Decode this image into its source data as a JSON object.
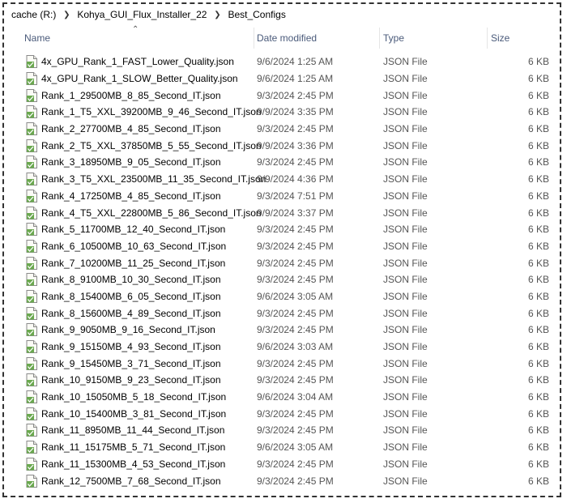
{
  "breadcrumb": [
    "cache (R:)",
    "Kohya_GUI_Flux_Installer_22",
    "Best_Configs"
  ],
  "columns": {
    "name": "Name",
    "date": "Date modified",
    "type": "Type",
    "size": "Size"
  },
  "icons": {
    "sort": "sort-ascending-icon",
    "separator": "chevron-right-icon",
    "file": "json-file-icon"
  },
  "files": [
    {
      "name": "4x_GPU_Rank_1_FAST_Lower_Quality.json",
      "date": "9/6/2024 1:25 AM",
      "type": "JSON File",
      "size": "6 KB"
    },
    {
      "name": "4x_GPU_Rank_1_SLOW_Better_Quality.json",
      "date": "9/6/2024 1:25 AM",
      "type": "JSON File",
      "size": "6 KB"
    },
    {
      "name": "Rank_1_29500MB_8_85_Second_IT.json",
      "date": "9/3/2024 2:45 PM",
      "type": "JSON File",
      "size": "6 KB"
    },
    {
      "name": "Rank_1_T5_XXL_39200MB_9_46_Second_IT.json",
      "date": "9/9/2024 3:35 PM",
      "type": "JSON File",
      "size": "6 KB"
    },
    {
      "name": "Rank_2_27700MB_4_85_Second_IT.json",
      "date": "9/3/2024 2:45 PM",
      "type": "JSON File",
      "size": "6 KB"
    },
    {
      "name": "Rank_2_T5_XXL_37850MB_5_55_Second_IT.json",
      "date": "9/9/2024 3:36 PM",
      "type": "JSON File",
      "size": "6 KB"
    },
    {
      "name": "Rank_3_18950MB_9_05_Second_IT.json",
      "date": "9/3/2024 2:45 PM",
      "type": "JSON File",
      "size": "6 KB"
    },
    {
      "name": "Rank_3_T5_XXL_23500MB_11_35_Second_IT.json",
      "date": "9/9/2024 4:36 PM",
      "type": "JSON File",
      "size": "6 KB"
    },
    {
      "name": "Rank_4_17250MB_4_85_Second_IT.json",
      "date": "9/3/2024 7:51 PM",
      "type": "JSON File",
      "size": "6 KB"
    },
    {
      "name": "Rank_4_T5_XXL_22800MB_5_86_Second_IT.json",
      "date": "9/9/2024 3:37 PM",
      "type": "JSON File",
      "size": "6 KB"
    },
    {
      "name": "Rank_5_11700MB_12_40_Second_IT.json",
      "date": "9/3/2024 2:45 PM",
      "type": "JSON File",
      "size": "6 KB"
    },
    {
      "name": "Rank_6_10500MB_10_63_Second_IT.json",
      "date": "9/3/2024 2:45 PM",
      "type": "JSON File",
      "size": "6 KB"
    },
    {
      "name": "Rank_7_10200MB_11_25_Second_IT.json",
      "date": "9/3/2024 2:45 PM",
      "type": "JSON File",
      "size": "6 KB"
    },
    {
      "name": "Rank_8_9100MB_10_30_Second_IT.json",
      "date": "9/3/2024 2:45 PM",
      "type": "JSON File",
      "size": "6 KB"
    },
    {
      "name": "Rank_8_15400MB_6_05_Second_IT.json",
      "date": "9/6/2024 3:05 AM",
      "type": "JSON File",
      "size": "6 KB"
    },
    {
      "name": "Rank_8_15600MB_4_89_Second_IT.json",
      "date": "9/3/2024 2:45 PM",
      "type": "JSON File",
      "size": "6 KB"
    },
    {
      "name": "Rank_9_9050MB_9_16_Second_IT.json",
      "date": "9/3/2024 2:45 PM",
      "type": "JSON File",
      "size": "6 KB"
    },
    {
      "name": "Rank_9_15150MB_4_93_Second_IT.json",
      "date": "9/6/2024 3:03 AM",
      "type": "JSON File",
      "size": "6 KB"
    },
    {
      "name": "Rank_9_15450MB_3_71_Second_IT.json",
      "date": "9/3/2024 2:45 PM",
      "type": "JSON File",
      "size": "6 KB"
    },
    {
      "name": "Rank_10_9150MB_9_23_Second_IT.json",
      "date": "9/3/2024 2:45 PM",
      "type": "JSON File",
      "size": "6 KB"
    },
    {
      "name": "Rank_10_15050MB_5_18_Second_IT.json",
      "date": "9/6/2024 3:04 AM",
      "type": "JSON File",
      "size": "6 KB"
    },
    {
      "name": "Rank_10_15400MB_3_81_Second_IT.json",
      "date": "9/3/2024 2:45 PM",
      "type": "JSON File",
      "size": "6 KB"
    },
    {
      "name": "Rank_11_8950MB_11_44_Second_IT.json",
      "date": "9/3/2024 2:45 PM",
      "type": "JSON File",
      "size": "6 KB"
    },
    {
      "name": "Rank_11_15175MB_5_71_Second_IT.json",
      "date": "9/6/2024 3:05 AM",
      "type": "JSON File",
      "size": "6 KB"
    },
    {
      "name": "Rank_11_15300MB_4_53_Second_IT.json",
      "date": "9/3/2024 2:45 PM",
      "type": "JSON File",
      "size": "6 KB"
    },
    {
      "name": "Rank_12_7500MB_7_68_Second_IT.json",
      "date": "9/3/2024 2:45 PM",
      "type": "JSON File",
      "size": "6 KB"
    }
  ]
}
